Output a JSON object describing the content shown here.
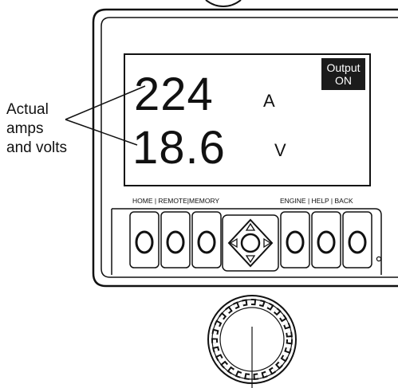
{
  "callout": {
    "line1": "Actual",
    "line2": "amps",
    "line3": "and volts"
  },
  "display": {
    "amps_value": "224",
    "amps_unit": "A",
    "volts_value": "18.6",
    "volts_unit": "V",
    "output_badge_line1": "Output",
    "output_badge_line2": "ON"
  },
  "soft_key_labels": {
    "left": "HOME | REMOTE|MEMORY",
    "right": "ENGINE | HELP | BACK"
  }
}
